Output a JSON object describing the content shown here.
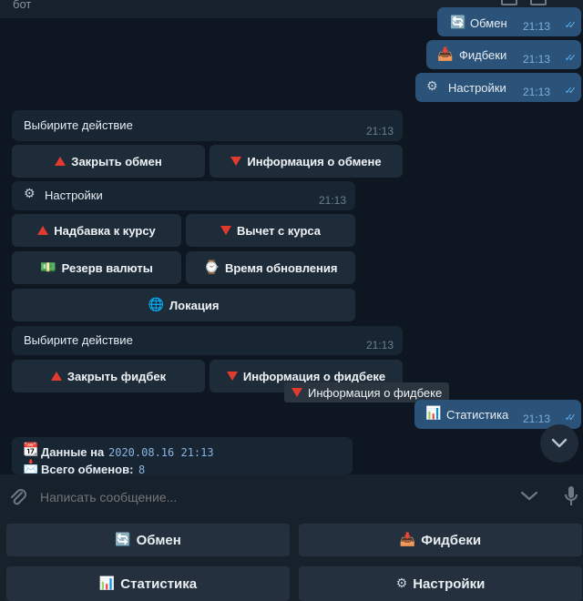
{
  "header": {
    "title": "бот"
  },
  "messages": {
    "out1": {
      "text": "Обмен",
      "time": "21:13",
      "icon": "refresh-icon"
    },
    "out2": {
      "text": "Фидбеки",
      "time": "21:13",
      "icon": "inbox-tray-icon"
    },
    "out3": {
      "text": "Настройки",
      "time": "21:13",
      "icon": "gear-icon"
    },
    "in1": {
      "text": "Выбирите действие",
      "time": "21:13",
      "buttons": [
        {
          "label": "Закрыть обмен",
          "icon": "red-triangle-up-icon"
        },
        {
          "label": "Информация о обмене",
          "icon": "red-triangle-down-icon"
        }
      ]
    },
    "in2": {
      "text": "Настройки",
      "time": "21:13",
      "icon": "gear-icon",
      "buttons": [
        {
          "label": "Надбавка к курсу",
          "icon": "red-triangle-up-icon"
        },
        {
          "label": "Вычет с курса",
          "icon": "red-triangle-down-icon"
        },
        {
          "label": "Резерв валюты",
          "icon": "money-icon"
        },
        {
          "label": "Время обновления",
          "icon": "watch-icon"
        },
        {
          "label": "Локация",
          "icon": "globe-icon"
        }
      ]
    },
    "in3": {
      "text": "Выбирите действие",
      "time": "21:13",
      "buttons": [
        {
          "label": "Закрыть фидбек",
          "icon": "red-triangle-up-icon"
        },
        {
          "label": "Информация о фидбеке",
          "icon": "red-triangle-down-icon"
        }
      ]
    },
    "tooltip": {
      "text": "Информация о фидбеке"
    },
    "out4": {
      "text": "Статистика",
      "time": "21:13",
      "icon": "bar-chart-icon"
    },
    "in4": {
      "line1_label": "Данные на",
      "line1_value": "2020.08.16 21:13",
      "line2_label": "Всего обменов:",
      "line2_value": "8"
    }
  },
  "input": {
    "placeholder": "Написать сообщение..."
  },
  "keyboard": [
    {
      "label": "Обмен",
      "icon": "refresh-icon"
    },
    {
      "label": "Фидбеки",
      "icon": "inbox-tray-icon"
    },
    {
      "label": "Статистика",
      "icon": "bar-chart-icon"
    },
    {
      "label": "Настройки",
      "icon": "gear-icon"
    }
  ],
  "colors": {
    "background": "#0e1621",
    "bubble_out": "#2b5278",
    "bubble_in": "#182533",
    "inline_button": "#1e2c3a",
    "accent_ticks": "#5eb5f7",
    "triangle": "#e23b2e"
  }
}
